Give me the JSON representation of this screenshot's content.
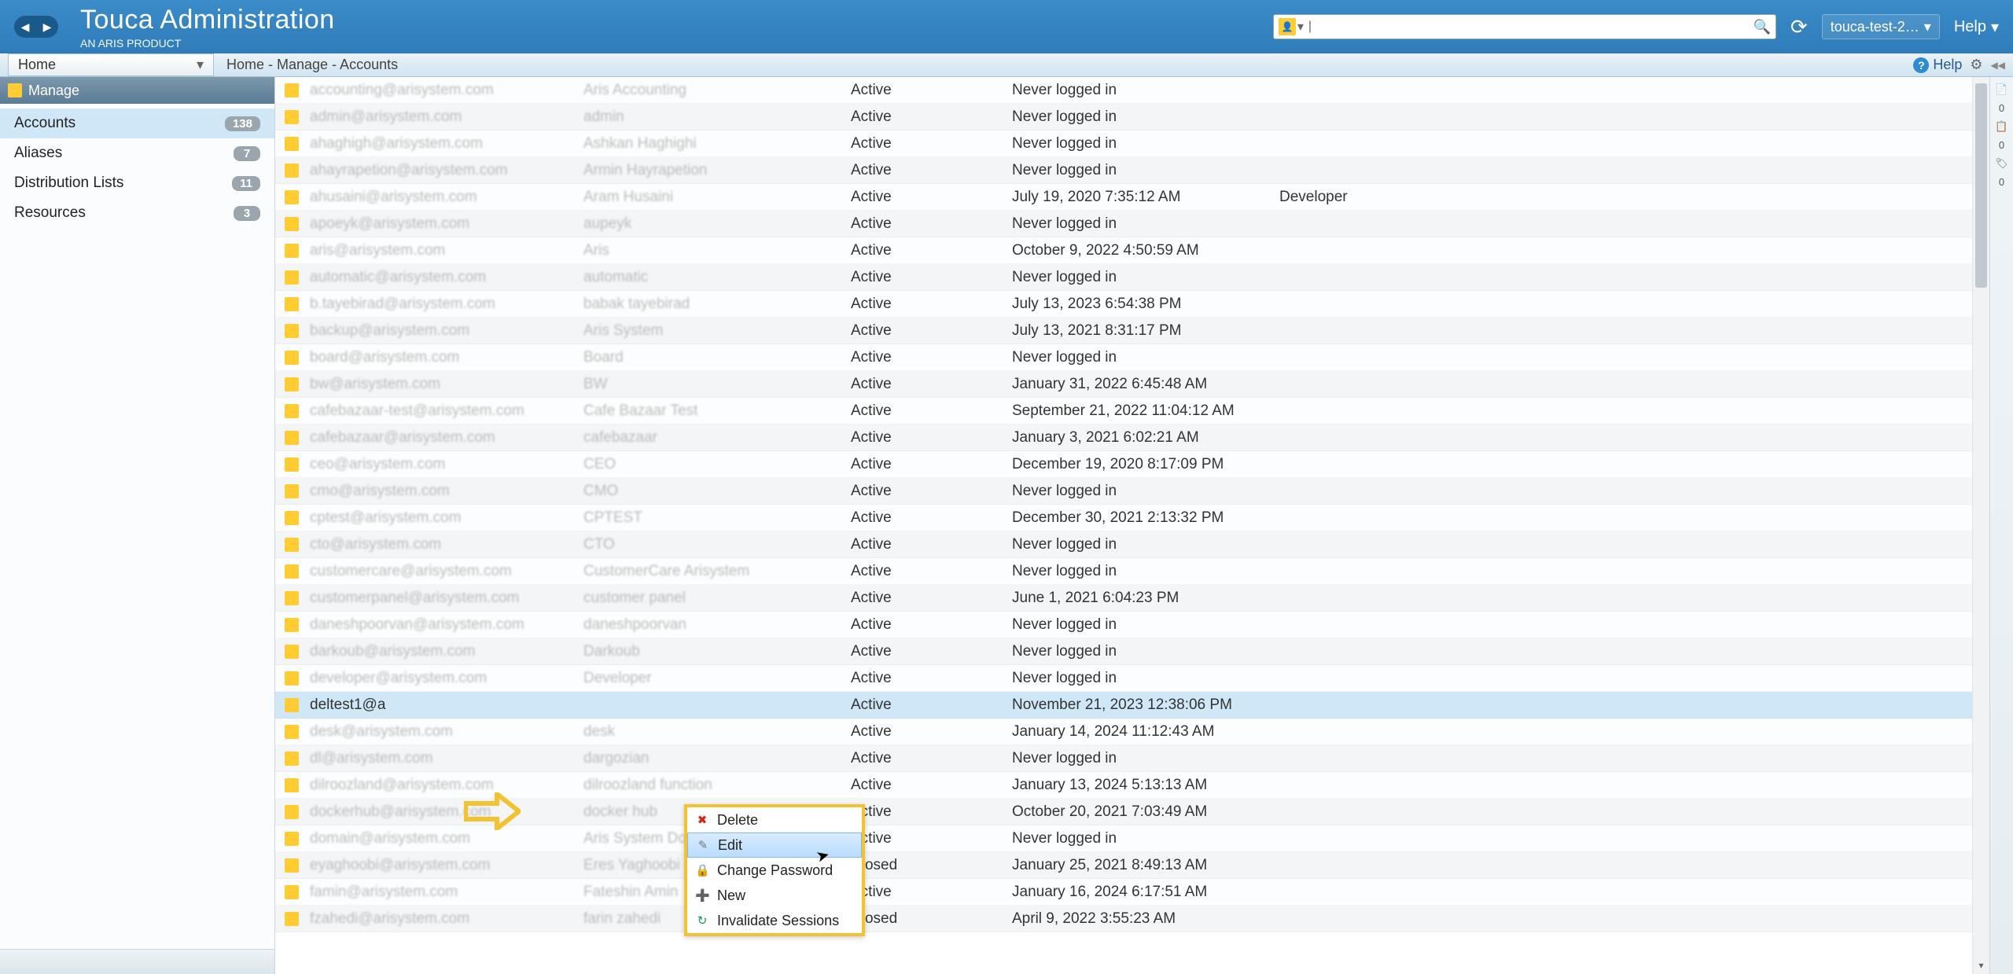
{
  "header": {
    "title": "Touca Administration",
    "subtitle": "AN ARIS PRODUCT",
    "search_placeholder": "",
    "search_value": "",
    "user_chip": "touca-test-2…",
    "help": "Help"
  },
  "toolbar": {
    "home_label": "Home",
    "breadcrumb": "Home - Manage - Accounts",
    "help_label": "Help"
  },
  "sidebar": {
    "header": "Manage",
    "items": [
      {
        "label": "Accounts",
        "count": "138",
        "active": true
      },
      {
        "label": "Aliases",
        "count": "7",
        "active": false
      },
      {
        "label": "Distribution Lists",
        "count": "11",
        "active": false
      },
      {
        "label": "Resources",
        "count": "3",
        "active": false
      }
    ]
  },
  "rows": [
    {
      "email": "accounting@arisystem.com",
      "name": "Aris Accounting",
      "status": "Active",
      "login": "Never logged in",
      "role": "",
      "blur": true
    },
    {
      "email": "admin@arisystem.com",
      "name": "admin",
      "status": "Active",
      "login": "Never logged in",
      "role": "",
      "blur": true
    },
    {
      "email": "ahaghigh@arisystem.com",
      "name": "Ashkan Haghighi",
      "status": "Active",
      "login": "Never logged in",
      "role": "",
      "blur": true
    },
    {
      "email": "ahayrapetion@arisystem.com",
      "name": "Armin Hayrapetion",
      "status": "Active",
      "login": "Never logged in",
      "role": "",
      "blur": true
    },
    {
      "email": "ahusaini@arisystem.com",
      "name": "Aram Husaini",
      "status": "Active",
      "login": "July 19, 2020 7:35:12 AM",
      "role": "Developer",
      "blur": true
    },
    {
      "email": "apoeyk@arisystem.com",
      "name": "aupeyk",
      "status": "Active",
      "login": "Never logged in",
      "role": "",
      "blur": true
    },
    {
      "email": "aris@arisystem.com",
      "name": "Aris",
      "status": "Active",
      "login": "October 9, 2022 4:50:59 AM",
      "role": "",
      "blur": true
    },
    {
      "email": "automatic@arisystem.com",
      "name": "automatic",
      "status": "Active",
      "login": "Never logged in",
      "role": "",
      "blur": true
    },
    {
      "email": "b.tayebirad@arisystem.com",
      "name": "babak tayebirad",
      "status": "Active",
      "login": "July 13, 2023 6:54:38 PM",
      "role": "",
      "blur": true
    },
    {
      "email": "backup@arisystem.com",
      "name": "Aris System",
      "status": "Active",
      "login": "July 13, 2021 8:31:17 PM",
      "role": "",
      "blur": true
    },
    {
      "email": "board@arisystem.com",
      "name": "Board",
      "status": "Active",
      "login": "Never logged in",
      "role": "",
      "blur": true
    },
    {
      "email": "bw@arisystem.com",
      "name": "BW",
      "status": "Active",
      "login": "January 31, 2022 6:45:48 AM",
      "role": "",
      "blur": true
    },
    {
      "email": "cafebazaar-test@arisystem.com",
      "name": "Cafe Bazaar Test",
      "status": "Active",
      "login": "September 21, 2022 11:04:12 AM",
      "role": "",
      "blur": true
    },
    {
      "email": "cafebazaar@arisystem.com",
      "name": "cafebazaar",
      "status": "Active",
      "login": "January 3, 2021 6:02:21 AM",
      "role": "",
      "blur": true
    },
    {
      "email": "ceo@arisystem.com",
      "name": "CEO",
      "status": "Active",
      "login": "December 19, 2020 8:17:09 PM",
      "role": "",
      "blur": true
    },
    {
      "email": "cmo@arisystem.com",
      "name": "CMO",
      "status": "Active",
      "login": "Never logged in",
      "role": "",
      "blur": true
    },
    {
      "email": "cptest@arisystem.com",
      "name": "CPTEST",
      "status": "Active",
      "login": "December 30, 2021 2:13:32 PM",
      "role": "",
      "blur": true
    },
    {
      "email": "cto@arisystem.com",
      "name": "CTO",
      "status": "Active",
      "login": "Never logged in",
      "role": "",
      "blur": true
    },
    {
      "email": "customercare@arisystem.com",
      "name": "CustomerCare Arisystem",
      "status": "Active",
      "login": "Never logged in",
      "role": "",
      "blur": true
    },
    {
      "email": "customerpanel@arisystem.com",
      "name": "customer panel",
      "status": "Active",
      "login": "June 1, 2021 6:04:23 PM",
      "role": "",
      "blur": true
    },
    {
      "email": "daneshpoorvan@arisystem.com",
      "name": "daneshpoorvan",
      "status": "Active",
      "login": "Never logged in",
      "role": "",
      "blur": true
    },
    {
      "email": "darkoub@arisystem.com",
      "name": "Darkoub",
      "status": "Active",
      "login": "Never logged in",
      "role": "",
      "blur": true
    },
    {
      "email": "developer@arisystem.com",
      "name": "Developer",
      "status": "Active",
      "login": "Never logged in",
      "role": "",
      "blur": true
    },
    {
      "email": "deltest1@a",
      "name": "",
      "status": "Active",
      "login": "November 21, 2023 12:38:06 PM",
      "role": "",
      "blur": false,
      "selected": true
    },
    {
      "email": "desk@arisystem.com",
      "name": "desk",
      "status": "Active",
      "login": "January 14, 2024 11:12:43 AM",
      "role": "",
      "blur": true
    },
    {
      "email": "dl@arisystem.com",
      "name": "dargozian",
      "status": "Active",
      "login": "Never logged in",
      "role": "",
      "blur": true
    },
    {
      "email": "dilroozland@arisystem.com",
      "name": "dilroozland function",
      "status": "Active",
      "login": "January 13, 2024 5:13:13 AM",
      "role": "",
      "blur": true
    },
    {
      "email": "dockerhub@arisystem.com",
      "name": "docker hub",
      "status": "Active",
      "login": "October 20, 2021 7:03:49 AM",
      "role": "",
      "blur": true
    },
    {
      "email": "domain@arisystem.com",
      "name": "Aris System Domain",
      "status": "Active",
      "login": "Never logged in",
      "role": "",
      "blur": true
    },
    {
      "email": "eyaghoobi@arisystem.com",
      "name": "Eres Yaghoobi",
      "status": "Closed",
      "login": "January 25, 2021 8:49:13 AM",
      "role": "",
      "blur": true
    },
    {
      "email": "famin@arisystem.com",
      "name": "Fateshin Amin",
      "status": "Active",
      "login": "January 16, 2024 6:17:51 AM",
      "role": "",
      "blur": true
    },
    {
      "email": "fzahedi@arisystem.com",
      "name": "farin zahedi",
      "status": "Closed",
      "login": "April 9, 2022 3:55:23 AM",
      "role": "",
      "blur": true
    }
  ],
  "context_menu": {
    "items": [
      {
        "label": "Delete",
        "icon": "✖",
        "cls": "red"
      },
      {
        "label": "Edit",
        "icon": "✎",
        "cls": "grey",
        "hover": true
      },
      {
        "label": "Change Password",
        "icon": "🔒",
        "cls": "grey"
      },
      {
        "label": "New",
        "icon": "➕",
        "cls": "blue"
      },
      {
        "label": "Invalidate Sessions",
        "icon": "↻",
        "cls": "green"
      }
    ]
  },
  "mini_rail": {
    "n1": "0",
    "n2": "0",
    "n3": "0"
  }
}
